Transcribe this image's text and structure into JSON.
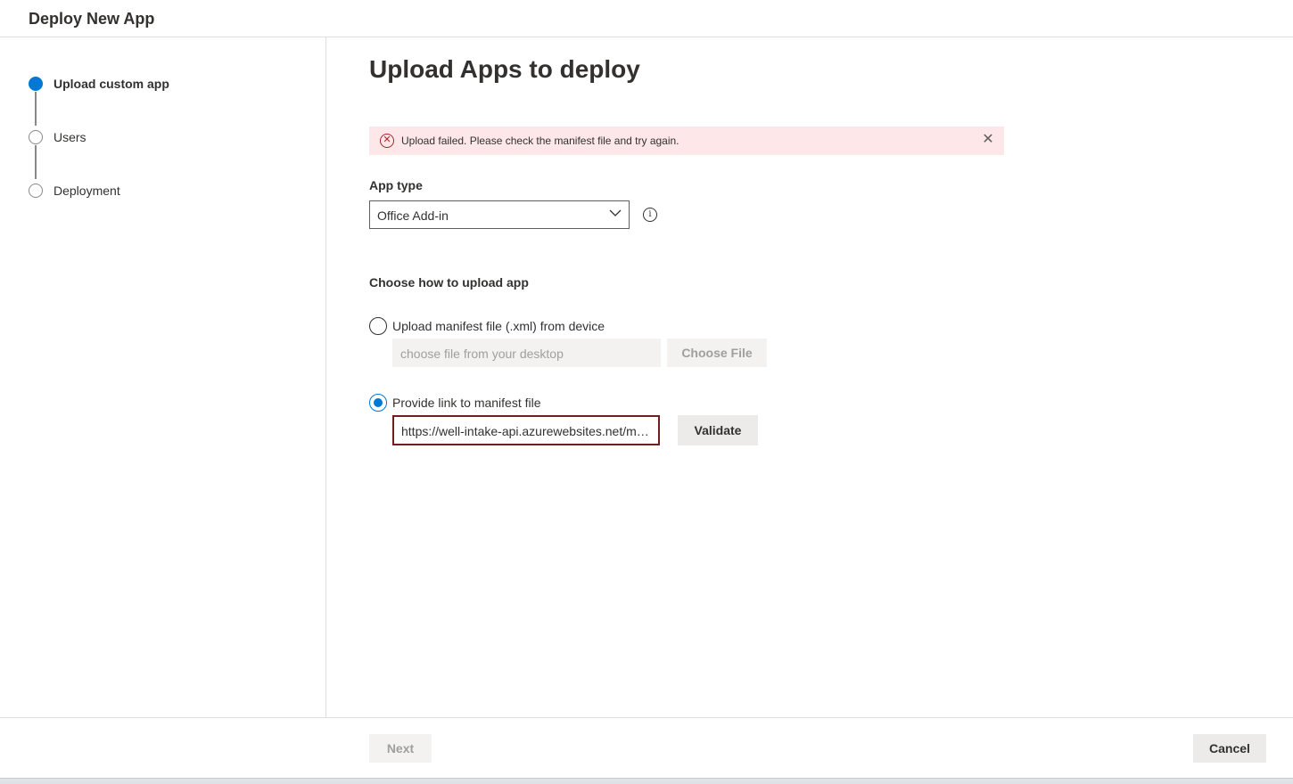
{
  "header": {
    "title": "Deploy New App"
  },
  "steps": [
    {
      "label": "Upload custom app",
      "state": "current"
    },
    {
      "label": "Users",
      "state": "pending"
    },
    {
      "label": "Deployment",
      "state": "pending"
    }
  ],
  "main": {
    "title": "Upload Apps to deploy",
    "error": {
      "message": "Upload failed. Please check the manifest file and try again.",
      "icon": "error-circle-icon"
    },
    "app_type": {
      "label": "App type",
      "selected": "Office Add-in"
    },
    "upload_section": {
      "heading": "Choose how to upload app",
      "option_file": {
        "label": "Upload manifest file (.xml) from device",
        "checked": false,
        "placeholder": "choose file from your desktop",
        "button": "Choose File"
      },
      "option_link": {
        "label": "Provide link to manifest file",
        "checked": true,
        "value": "https://well-intake-api.azurewebsites.net/manifest.xml",
        "button": "Validate"
      }
    }
  },
  "footer": {
    "next": "Next",
    "cancel": "Cancel"
  },
  "colors": {
    "accent": "#0078d4",
    "error_bg": "#fde7e9",
    "error_fg": "#a4262c"
  }
}
